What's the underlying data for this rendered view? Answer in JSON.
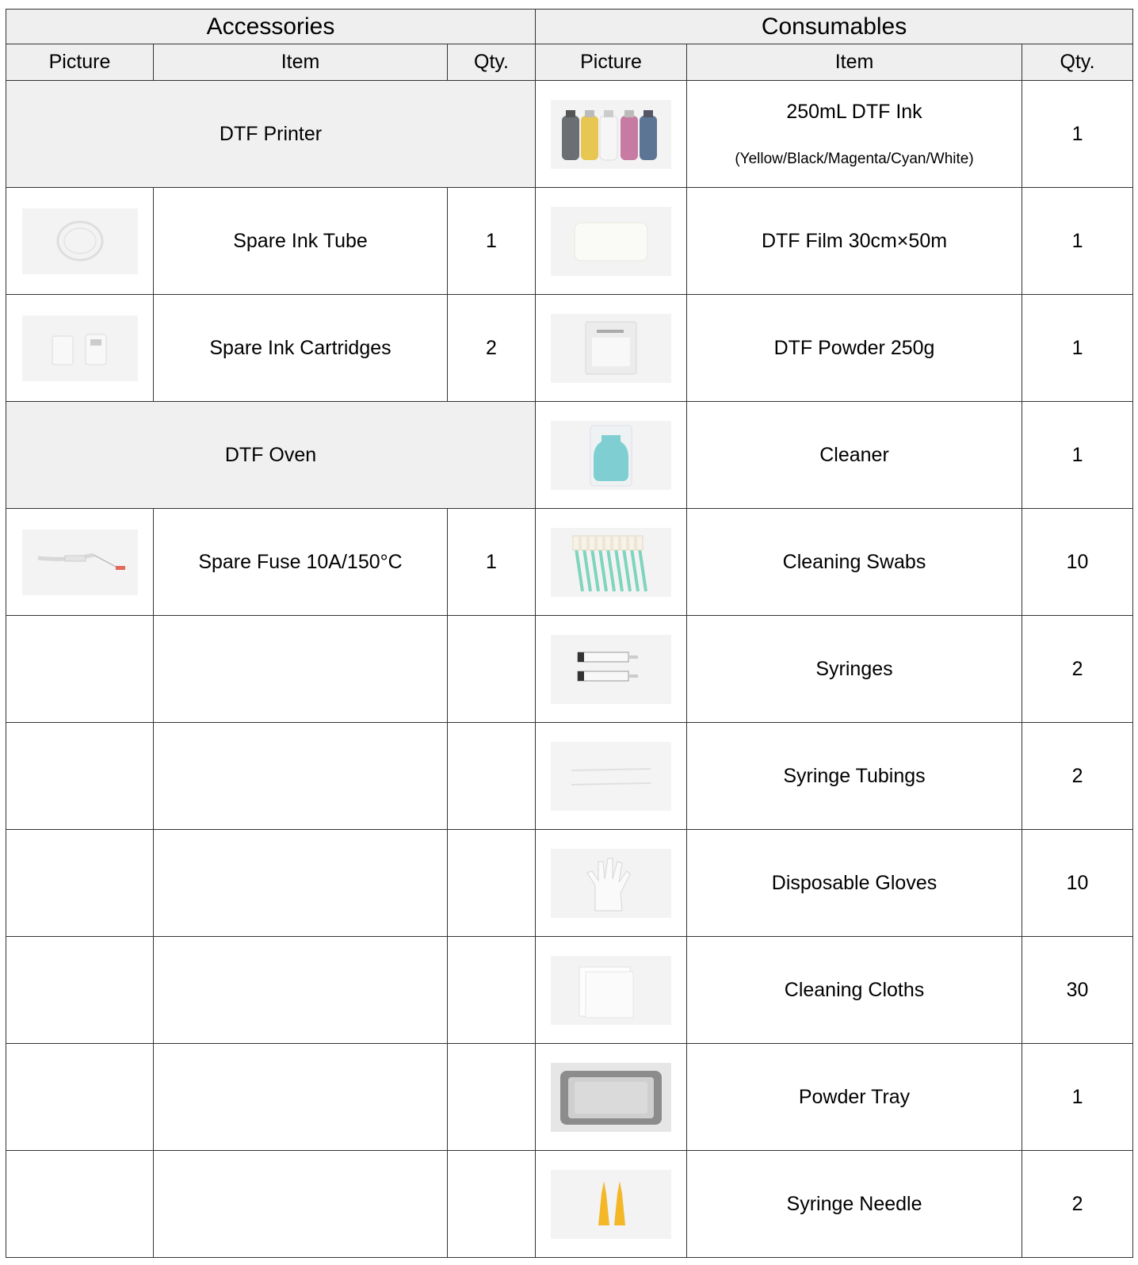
{
  "accessories": {
    "title": "Accessories",
    "headers": {
      "picture": "Picture",
      "item": "Item",
      "qty": "Qty."
    },
    "groups": {
      "printer": "DTF Printer",
      "oven": "DTF Oven"
    },
    "items": [
      {
        "name": "Spare Ink Tube",
        "qty": "1",
        "icon": "ink-tube-photo"
      },
      {
        "name": "Spare Ink Cartridges",
        "qty": "2",
        "icon": "ink-cartridges-photo"
      },
      {
        "name": "Spare Fuse 10A/150°C",
        "qty": "1",
        "icon": "fuse-photo"
      }
    ]
  },
  "consumables": {
    "title": "Consumables",
    "headers": {
      "picture": "Picture",
      "item": "Item",
      "qty": "Qty."
    },
    "items": [
      {
        "name": "250mL DTF Ink",
        "sub": "(Yellow/Black/Magenta/Cyan/White)",
        "qty": "1",
        "icon": "ink-bottles-photo"
      },
      {
        "name": "DTF Film 30cm×50m",
        "qty": "1",
        "icon": "film-roll-photo"
      },
      {
        "name": "DTF Powder 250g",
        "qty": "1",
        "icon": "powder-bag-photo"
      },
      {
        "name": "Cleaner",
        "qty": "1",
        "icon": "cleaner-bottle-photo"
      },
      {
        "name": "Cleaning Swabs",
        "qty": "10",
        "icon": "swabs-photo"
      },
      {
        "name": "Syringes",
        "qty": "2",
        "icon": "syringes-photo"
      },
      {
        "name": "Syringe Tubings",
        "qty": "2",
        "icon": "tubings-photo"
      },
      {
        "name": "Disposable Gloves",
        "qty": "10",
        "icon": "gloves-photo"
      },
      {
        "name": "Cleaning Cloths",
        "qty": "30",
        "icon": "cloths-photo"
      },
      {
        "name": "Powder Tray",
        "qty": "1",
        "icon": "tray-photo"
      },
      {
        "name": "Syringe Needle",
        "qty": "2",
        "icon": "needles-photo"
      }
    ]
  }
}
